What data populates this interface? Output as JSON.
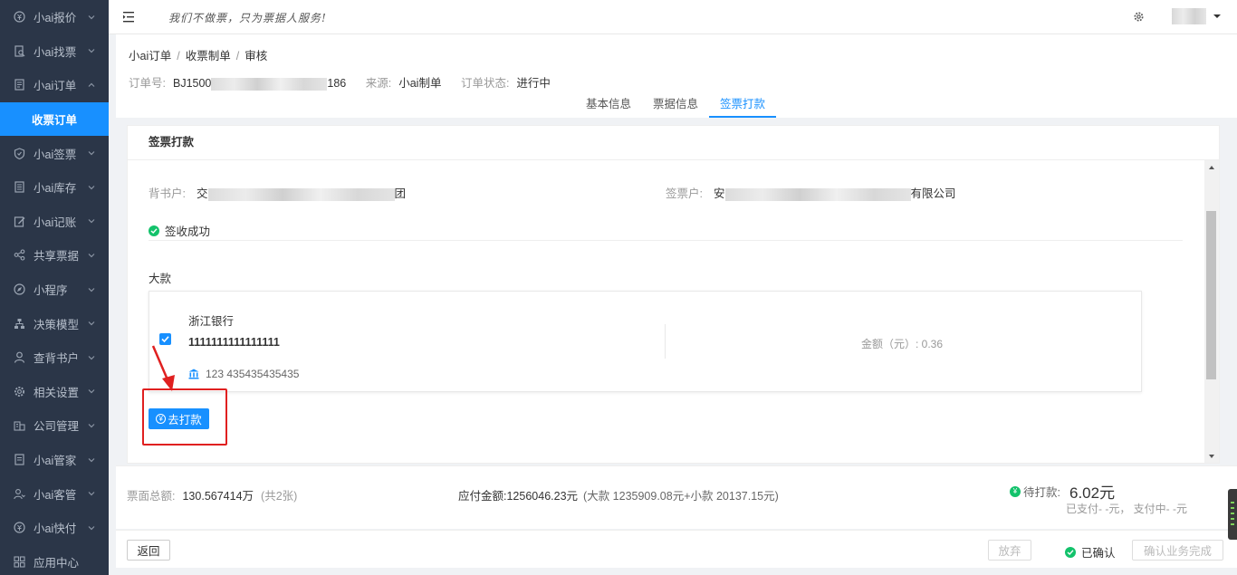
{
  "sidebar": {
    "items": [
      {
        "label": "小ai报价",
        "icon": "quote-icon",
        "chevron": "down"
      },
      {
        "label": "小ai找票",
        "icon": "search-doc-icon",
        "chevron": "down"
      },
      {
        "label": "小ai订单",
        "icon": "order-icon",
        "chevron": "up"
      },
      {
        "label": "收票订单",
        "active": true
      },
      {
        "label": "小ai签票",
        "icon": "shield-icon",
        "chevron": "down"
      },
      {
        "label": "小ai库存",
        "icon": "inventory-icon",
        "chevron": "down"
      },
      {
        "label": "小ai记账",
        "icon": "edit-icon",
        "chevron": "down"
      },
      {
        "label": "共享票据",
        "icon": "share-icon",
        "chevron": "down"
      },
      {
        "label": "小程序",
        "icon": "compass-icon",
        "chevron": "down"
      },
      {
        "label": "决策模型",
        "icon": "hierarchy-icon",
        "chevron": "down"
      },
      {
        "label": "查背书户",
        "icon": "user-icon",
        "chevron": "down"
      },
      {
        "label": "相关设置",
        "icon": "gear-icon",
        "chevron": "down"
      },
      {
        "label": "公司管理",
        "icon": "company-icon",
        "chevron": "down"
      },
      {
        "label": "小ai管家",
        "icon": "doc-icon",
        "chevron": "down"
      },
      {
        "label": "小ai客管",
        "icon": "users-icon",
        "chevron": "down"
      },
      {
        "label": "小ai快付",
        "icon": "pay-icon",
        "chevron": "down"
      },
      {
        "label": "应用中心",
        "icon": "grid-icon",
        "chevron": ""
      }
    ]
  },
  "topbar": {
    "slogan": "我们不做票，只为票据人服务!"
  },
  "breadcrumb": [
    "小ai订单",
    "收票制单",
    "审核"
  ],
  "meta": {
    "order_no_label": "订单号:",
    "order_no_prefix": "BJ1500",
    "order_no_suffix": "186",
    "source_label": "来源:",
    "source_value": "小ai制单",
    "status_label": "订单状态:",
    "status_value": "进行中"
  },
  "tabs": [
    {
      "label": "基本信息",
      "active": false
    },
    {
      "label": "票据信息",
      "active": false
    },
    {
      "label": "签票打款",
      "active": true
    }
  ],
  "panel": {
    "title": "签票打款",
    "holder_label": "背书户:",
    "holder_prefix": "交",
    "holder_suffix": "团",
    "signer_label": "签票户:",
    "signer_prefix": "安",
    "signer_suffix": "有限公司",
    "success_text": "签收成功",
    "section_label": "大款",
    "card": {
      "bank_name": "浙江银行",
      "account_number": "1111111111111111",
      "bank_line": "123 435435435435",
      "amount_text": "金额（元）: 0.36",
      "checked": true
    },
    "pay_button": "去打款"
  },
  "summary": {
    "total_label": "票面总额:",
    "total_value": "130.567414万",
    "total_count": "(共2张)",
    "payable_label": "应付金额:",
    "payable_value": "1256046.23元",
    "payable_detail": "(大款 1235909.08元+小款 20137.15元)",
    "pending_label": "待打款:",
    "pending_value": "6.02元",
    "paid_line": "已支付- -元，  支付中- -元"
  },
  "footer": {
    "back": "返回",
    "give_up": "放弃",
    "confirmed": "已确认",
    "finish": "确认业务完成"
  },
  "colors": {
    "sidebar_bg": "#2b3648",
    "accent": "#1890ff",
    "success": "#13c26b",
    "annotation": "#e02020"
  }
}
